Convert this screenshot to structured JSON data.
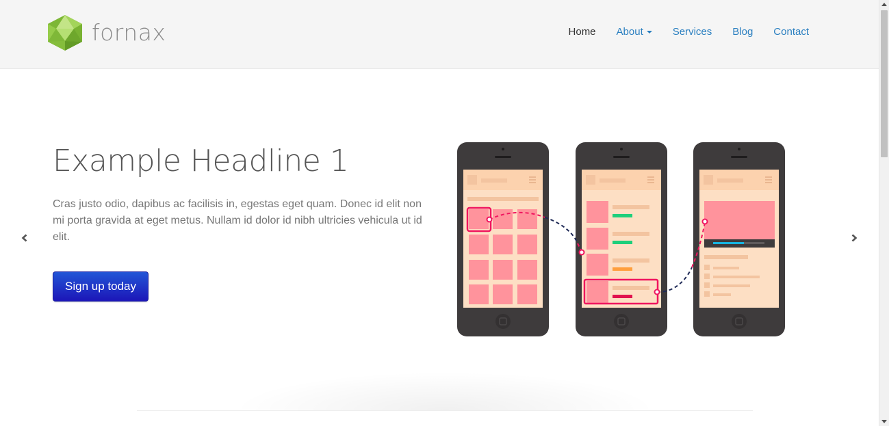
{
  "brand": {
    "name": "fornax",
    "logo_icon": "icosahedron-logo-icon",
    "logo_color": "#8cc63f"
  },
  "nav": {
    "items": [
      {
        "label": "Home",
        "active": true
      },
      {
        "label": "About",
        "dropdown": true
      },
      {
        "label": "Services"
      },
      {
        "label": "Blog"
      },
      {
        "label": "Contact"
      }
    ],
    "link_color": "#2a7fc0",
    "active_color": "#333333"
  },
  "hero": {
    "headline": "Example Headline 1",
    "lead": "Cras justo odio, dapibus ac facilisis in, egestas eget quam. Donec id elit non mi porta gravida at eget metus. Nullam id dolor id nibh ultricies vehicula ut id elit.",
    "cta_label": "Sign up today",
    "cta_color": "#1f2fc6",
    "illustration": "three-phones-app-flow-illustration"
  },
  "carousel": {
    "prev_icon": "chevron-left-icon",
    "next_icon": "chevron-right-icon"
  },
  "colors": {
    "header_bg": "#f5f5f5",
    "accent_pink": "#f0155f",
    "screen_bg": "#fddfc4",
    "phone_body": "#3e3b3c"
  }
}
